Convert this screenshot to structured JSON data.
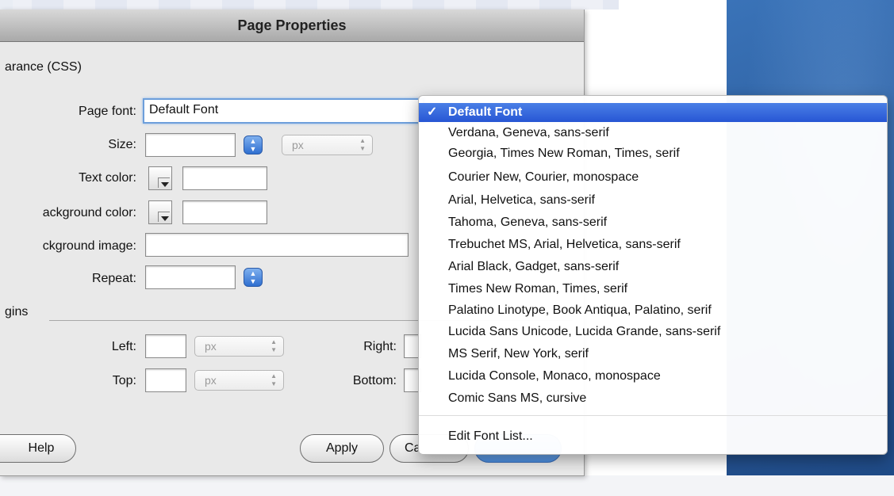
{
  "dialog": {
    "title": "Page Properties",
    "section_title": "arance (CSS)",
    "labels": {
      "page_font": "Page font:",
      "size": "Size:",
      "text_color": "Text color:",
      "background_color": "ackground color:",
      "background_image": "ckground image:",
      "repeat": "Repeat:",
      "margins": "gins",
      "left": "Left:",
      "right": "Right:",
      "top": "Top:",
      "bottom": "Bottom:"
    },
    "page_font_value": "Default Font",
    "unit_px": "px",
    "buttons": {
      "help": "Help",
      "apply": "Apply",
      "cancel_partial": "Ca"
    }
  },
  "font_menu": {
    "items": [
      "Default Font",
      "Verdana, Geneva, sans-serif",
      "Georgia, Times New Roman, Times, serif",
      "Courier New, Courier, monospace",
      "Arial, Helvetica, sans-serif",
      "Tahoma, Geneva, sans-serif",
      "Trebuchet MS, Arial, Helvetica, sans-serif",
      "Arial Black, Gadget, sans-serif",
      "Times New Roman, Times, serif",
      "Palatino Linotype, Book Antiqua, Palatino, serif",
      "Lucida Sans Unicode, Lucida Grande, sans-serif",
      "MS Serif, New York, serif",
      "Lucida Console, Monaco, monospace",
      "Comic Sans MS, cursive"
    ],
    "selected_index": 0,
    "check_mark": "✓",
    "edit_label": "Edit Font List..."
  },
  "colors": {
    "menu_highlight": "#2e61d9",
    "focus_ring": "#6d9fdb",
    "desktop": "#2d5fa0"
  }
}
